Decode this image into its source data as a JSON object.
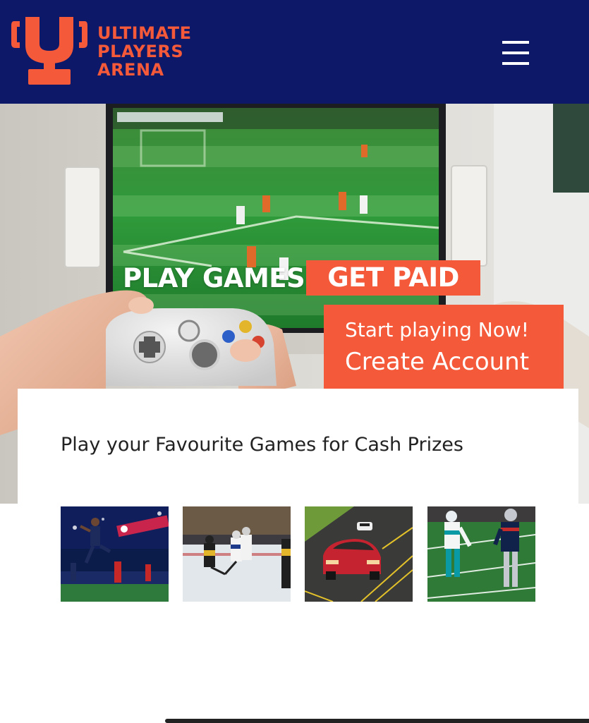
{
  "brand": {
    "name_lines": [
      "ULTIMATE",
      "PLAYERS",
      "ARENA"
    ],
    "colors": {
      "navy": "#0e1868",
      "accent": "#f4593a"
    },
    "logo_icon": "trophy-u-icon"
  },
  "header": {
    "menu_icon": "hamburger-menu-icon"
  },
  "hero": {
    "headline_part1": "PLAY GAMES",
    "headline_part2": "GET PAID",
    "cta_line1": "Start playing Now!",
    "cta_line2": "Create Account"
  },
  "games_section": {
    "title": "Play your Favourite Games for Cash Prizes",
    "games": [
      {
        "id": "football-soccer"
      },
      {
        "id": "ice-hockey"
      },
      {
        "id": "car-racing"
      },
      {
        "id": "american-football"
      }
    ]
  }
}
